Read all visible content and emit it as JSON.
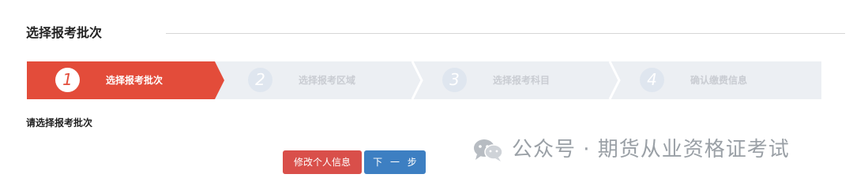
{
  "section": {
    "title": "选择报考批次"
  },
  "steps": [
    {
      "number": "1",
      "label": "选择报考批次",
      "state": "active"
    },
    {
      "number": "2",
      "label": "选择报考区域",
      "state": "inactive"
    },
    {
      "number": "3",
      "label": "选择报考科目",
      "state": "inactive"
    },
    {
      "number": "4",
      "label": "确认缴费信息",
      "state": "inactive"
    }
  ],
  "prompt": "请选择报考批次",
  "buttons": {
    "edit_info": "修改个人信息",
    "next": "下 一 步"
  },
  "watermark": {
    "text": "公众号 · 期货从业资格证考试",
    "icon": "wechat-icon"
  },
  "colors": {
    "active_step": "#e34c3a",
    "inactive_step": "#eceff3",
    "edit_button": "#d94f4a",
    "next_button": "#3d7fc2"
  }
}
